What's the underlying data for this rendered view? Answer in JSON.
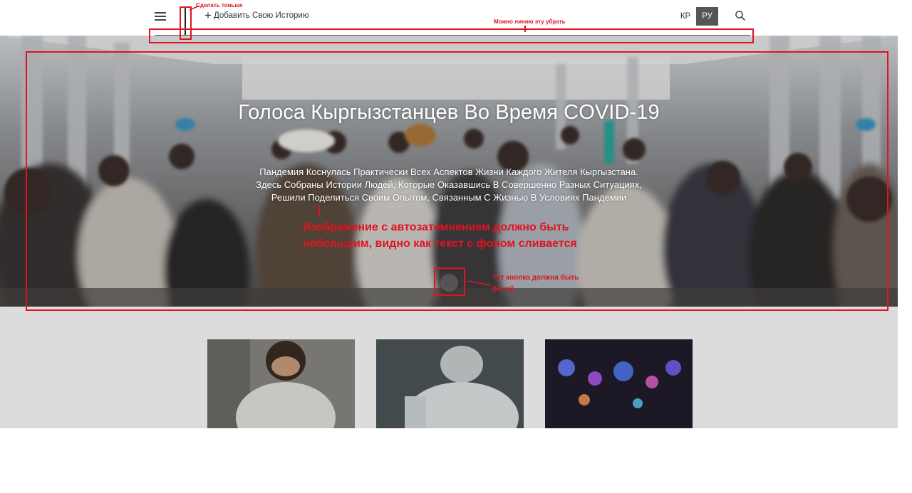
{
  "header": {
    "add_story_label": "Добавить Свою Историю",
    "lang_kr": "КР",
    "lang_ru": "РУ",
    "active_lang": "РУ"
  },
  "hero": {
    "title": "Голоса Кыргызстанцев Во Время COVID-19",
    "description_lines": [
      "Пандемия Коснулась Практически Всех Аспектов Жизни Каждого Жителя Кыргызстана.",
      "Здесь Собраны Истории Людей, Которые Оказавшись В Совершенно Разных Ситуациях,",
      "Решили Поделиться Своим Опытом, Связанным С Жизнью В Условиях Пандемии"
    ]
  },
  "cards": [
    {
      "icon": "photo-smiling-person"
    },
    {
      "icon": "photo-medical-worker"
    },
    {
      "icon": "photo-city-lights"
    }
  ],
  "annotations": {
    "make_thinner": "Сделать тоньше",
    "remove_line": "Можно линию эту убрать",
    "image_dim_line1": "Изображение с автозатемнением должно быть",
    "image_dim_line2": "небольшим, видно как текст с фоном сливается",
    "button_white_line1": "Тут кнопка должна быть",
    "button_white_line2": "белой"
  },
  "colors": {
    "annotation_red": "#e0141e",
    "active_lang_bg": "#555555",
    "section_grey": "#dcdcdc"
  }
}
